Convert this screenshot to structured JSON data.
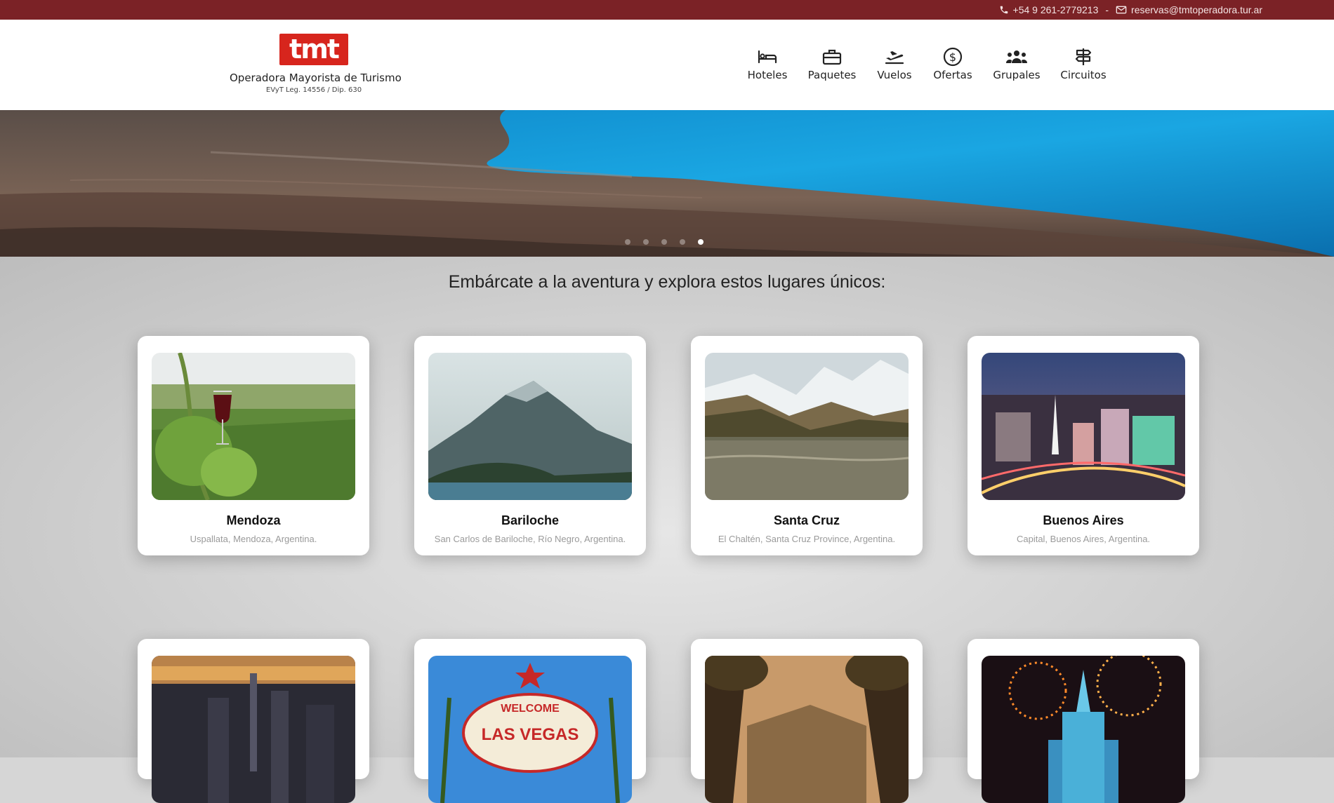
{
  "topbar": {
    "phone": "+54 9 261-2779213",
    "separator": "-",
    "email": "reservas@tmtoperadora.tur.ar"
  },
  "brand": {
    "logo_text": "tmt",
    "name": "Operadora Mayorista de Turismo",
    "legal": "EVyT Leg. 14556 / Dip. 630"
  },
  "nav": [
    {
      "label": "Hoteles",
      "icon": "bed-icon"
    },
    {
      "label": "Paquetes",
      "icon": "suitcase-icon"
    },
    {
      "label": "Vuelos",
      "icon": "plane-departure-icon"
    },
    {
      "label": "Ofertas",
      "icon": "dollar-circle-icon"
    },
    {
      "label": "Grupales",
      "icon": "users-icon"
    },
    {
      "label": "Circuitos",
      "icon": "signpost-icon"
    }
  ],
  "hero": {
    "slides_total": 5,
    "active_slide": 5
  },
  "headline": "Embárcate a la aventura y explora estos lugares únicos:",
  "destinations": [
    {
      "title": "Mendoza",
      "location": "Uspallata, Mendoza, Argentina."
    },
    {
      "title": "Bariloche",
      "location": "San Carlos de Bariloche, Río Negro, Argentina."
    },
    {
      "title": "Santa Cruz",
      "location": "El Chaltén, Santa Cruz Province, Argentina."
    },
    {
      "title": "Buenos Aires",
      "location": "Capital, Buenos Aires, Argentina."
    }
  ],
  "second_row_images": [
    "city-skyline-sunset",
    "las-vegas-sign",
    "hollywood-palms",
    "castle-fireworks"
  ],
  "colors": {
    "topbar": "#7b2226",
    "logo": "#d7251d",
    "header_bg": "#ffffff",
    "page_bg": "#d6d6d6"
  }
}
